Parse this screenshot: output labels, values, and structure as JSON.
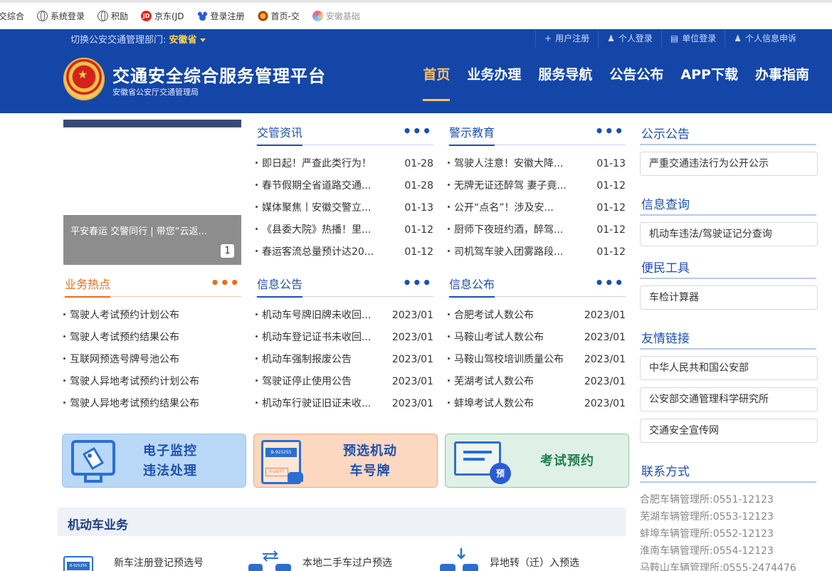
{
  "bookmarks": [
    {
      "label": "交综合",
      "icon": "globe-icon"
    },
    {
      "label": "系统登录",
      "icon": "globe-icon"
    },
    {
      "label": "积励",
      "icon": "globe-icon"
    },
    {
      "label": "京东(JD",
      "icon": "jd-icon"
    },
    {
      "label": "登录注册",
      "icon": "paw-icon"
    },
    {
      "label": "首页-交",
      "icon": "badge-icon"
    },
    {
      "label": "安徽基础",
      "icon": "cloud-icon"
    }
  ],
  "topbar": {
    "switch_label": "切换公安交通管理部门:",
    "province": "安徽省",
    "links": [
      {
        "label": "用户注册",
        "glyph": "+"
      },
      {
        "label": "个人登录",
        "glyph": "♟"
      },
      {
        "label": "单位登录",
        "glyph": "▤"
      },
      {
        "label": "个人信息申诉",
        "glyph": "♟"
      }
    ]
  },
  "header": {
    "title": "交通安全综合服务管理平台",
    "subtitle": "安徽省公安厅交通管理局",
    "nav": [
      "首页",
      "业务办理",
      "服务导航",
      "公告公布",
      "APP下载",
      "办事指南"
    ]
  },
  "slide": {
    "caption": "平安春运 交警同行 | 带您“云返...",
    "index": "1"
  },
  "panels": {
    "jiaoguan": {
      "title": "交管资讯",
      "more": "•••",
      "items": [
        {
          "text": "即日起！严查此类行为！",
          "date": "01-28"
        },
        {
          "text": "春节假期全省道路交通...",
          "date": "01-28"
        },
        {
          "text": "媒体聚焦丨安徽交警立...",
          "date": "01-13"
        },
        {
          "text": "《县委大院》热播！里...",
          "date": "01-12"
        },
        {
          "text": "春运客流总量预计达20...",
          "date": "01-12"
        }
      ]
    },
    "jingshi": {
      "title": "警示教育",
      "more": "•••",
      "items": [
        {
          "text": "驾驶人注意！安徽大降...",
          "date": "01-13"
        },
        {
          "text": "无牌无证还醉驾 妻子竟...",
          "date": "01-12"
        },
        {
          "text": "公开“点名”！涉及安...",
          "date": "01-12"
        },
        {
          "text": "厨师下夜班约酒，醉驾...",
          "date": "01-12"
        },
        {
          "text": "司机驾车驶入团雾路段...",
          "date": "01-12"
        }
      ]
    },
    "yewu": {
      "title": "业务热点",
      "more": "•••",
      "items": [
        {
          "text": "驾驶人考试预约计划公布"
        },
        {
          "text": "驾驶人考试预约结果公布"
        },
        {
          "text": "互联网预选号牌号池公布"
        },
        {
          "text": "驾驶人异地考试预约计划公布"
        },
        {
          "text": "驾驶人异地考试预约结果公布"
        }
      ]
    },
    "xinxi_gonggao": {
      "title": "信息公告",
      "more": "•••",
      "items": [
        {
          "text": "机动车号牌旧牌未收回...",
          "date": "2023/01"
        },
        {
          "text": "机动车登记证书未收回...",
          "date": "2023/01"
        },
        {
          "text": "机动车强制报废公告",
          "date": "2023/01"
        },
        {
          "text": "驾驶证停止使用公告",
          "date": "2023/01"
        },
        {
          "text": "机动车行驶证旧证未收...",
          "date": "2023/01"
        }
      ]
    },
    "xinxi_gongbu": {
      "title": "信息公布",
      "more": "•••",
      "items": [
        {
          "text": "合肥考试人数公布",
          "date": "2023/01"
        },
        {
          "text": "马鞍山考试人数公布",
          "date": "2023/01"
        },
        {
          "text": "马鞍山驾校培训质量公布",
          "date": "2023/01"
        },
        {
          "text": "芜湖考试人数公布",
          "date": "2023/01"
        },
        {
          "text": "蚌埠考试人数公布",
          "date": "2023/01"
        }
      ]
    }
  },
  "sidebar": {
    "gongshi": {
      "title": "公示公告",
      "items": [
        "严重交通违法行为公开公示"
      ]
    },
    "chaxun": {
      "title": "信息查询",
      "items": [
        "机动车违法/驾驶证记分查询"
      ]
    },
    "gongju": {
      "title": "便民工具",
      "items": [
        "车检计算器"
      ]
    },
    "lianjie": {
      "title": "友情链接",
      "items": [
        "中华人民共和国公安部",
        "公安部交通管理科学研究所",
        "交通安全宣传网"
      ]
    },
    "lianxi": {
      "title": "联系方式",
      "items": [
        "合肥车辆管理所:0551-12123",
        "芜湖车辆管理所:0553-12123",
        "蚌埠车辆管理所:0552-12123",
        "淮南车辆管理所:0554-12123",
        "马鞍山车辆管理所:0555-2474476"
      ]
    }
  },
  "bigbuttons": [
    {
      "line1": "电子监控",
      "line2": "违法处理"
    },
    {
      "line1": "预选机动",
      "line2": "车号牌",
      "plate1": "B-925255",
      "plate2": "F-2977"
    },
    {
      "line1": "考试预约",
      "badge": "预"
    }
  ],
  "section": {
    "title": "机动车业务",
    "services": [
      {
        "label": "新车注册登记预选号",
        "plate": "B-925255"
      },
      {
        "label": "本地二手车过户预选"
      },
      {
        "label": "异地转（迁）入预选"
      }
    ]
  },
  "colors": {
    "brand": "#1446a8",
    "accent": "#ffc06a",
    "orange": "#ef6b1a"
  }
}
